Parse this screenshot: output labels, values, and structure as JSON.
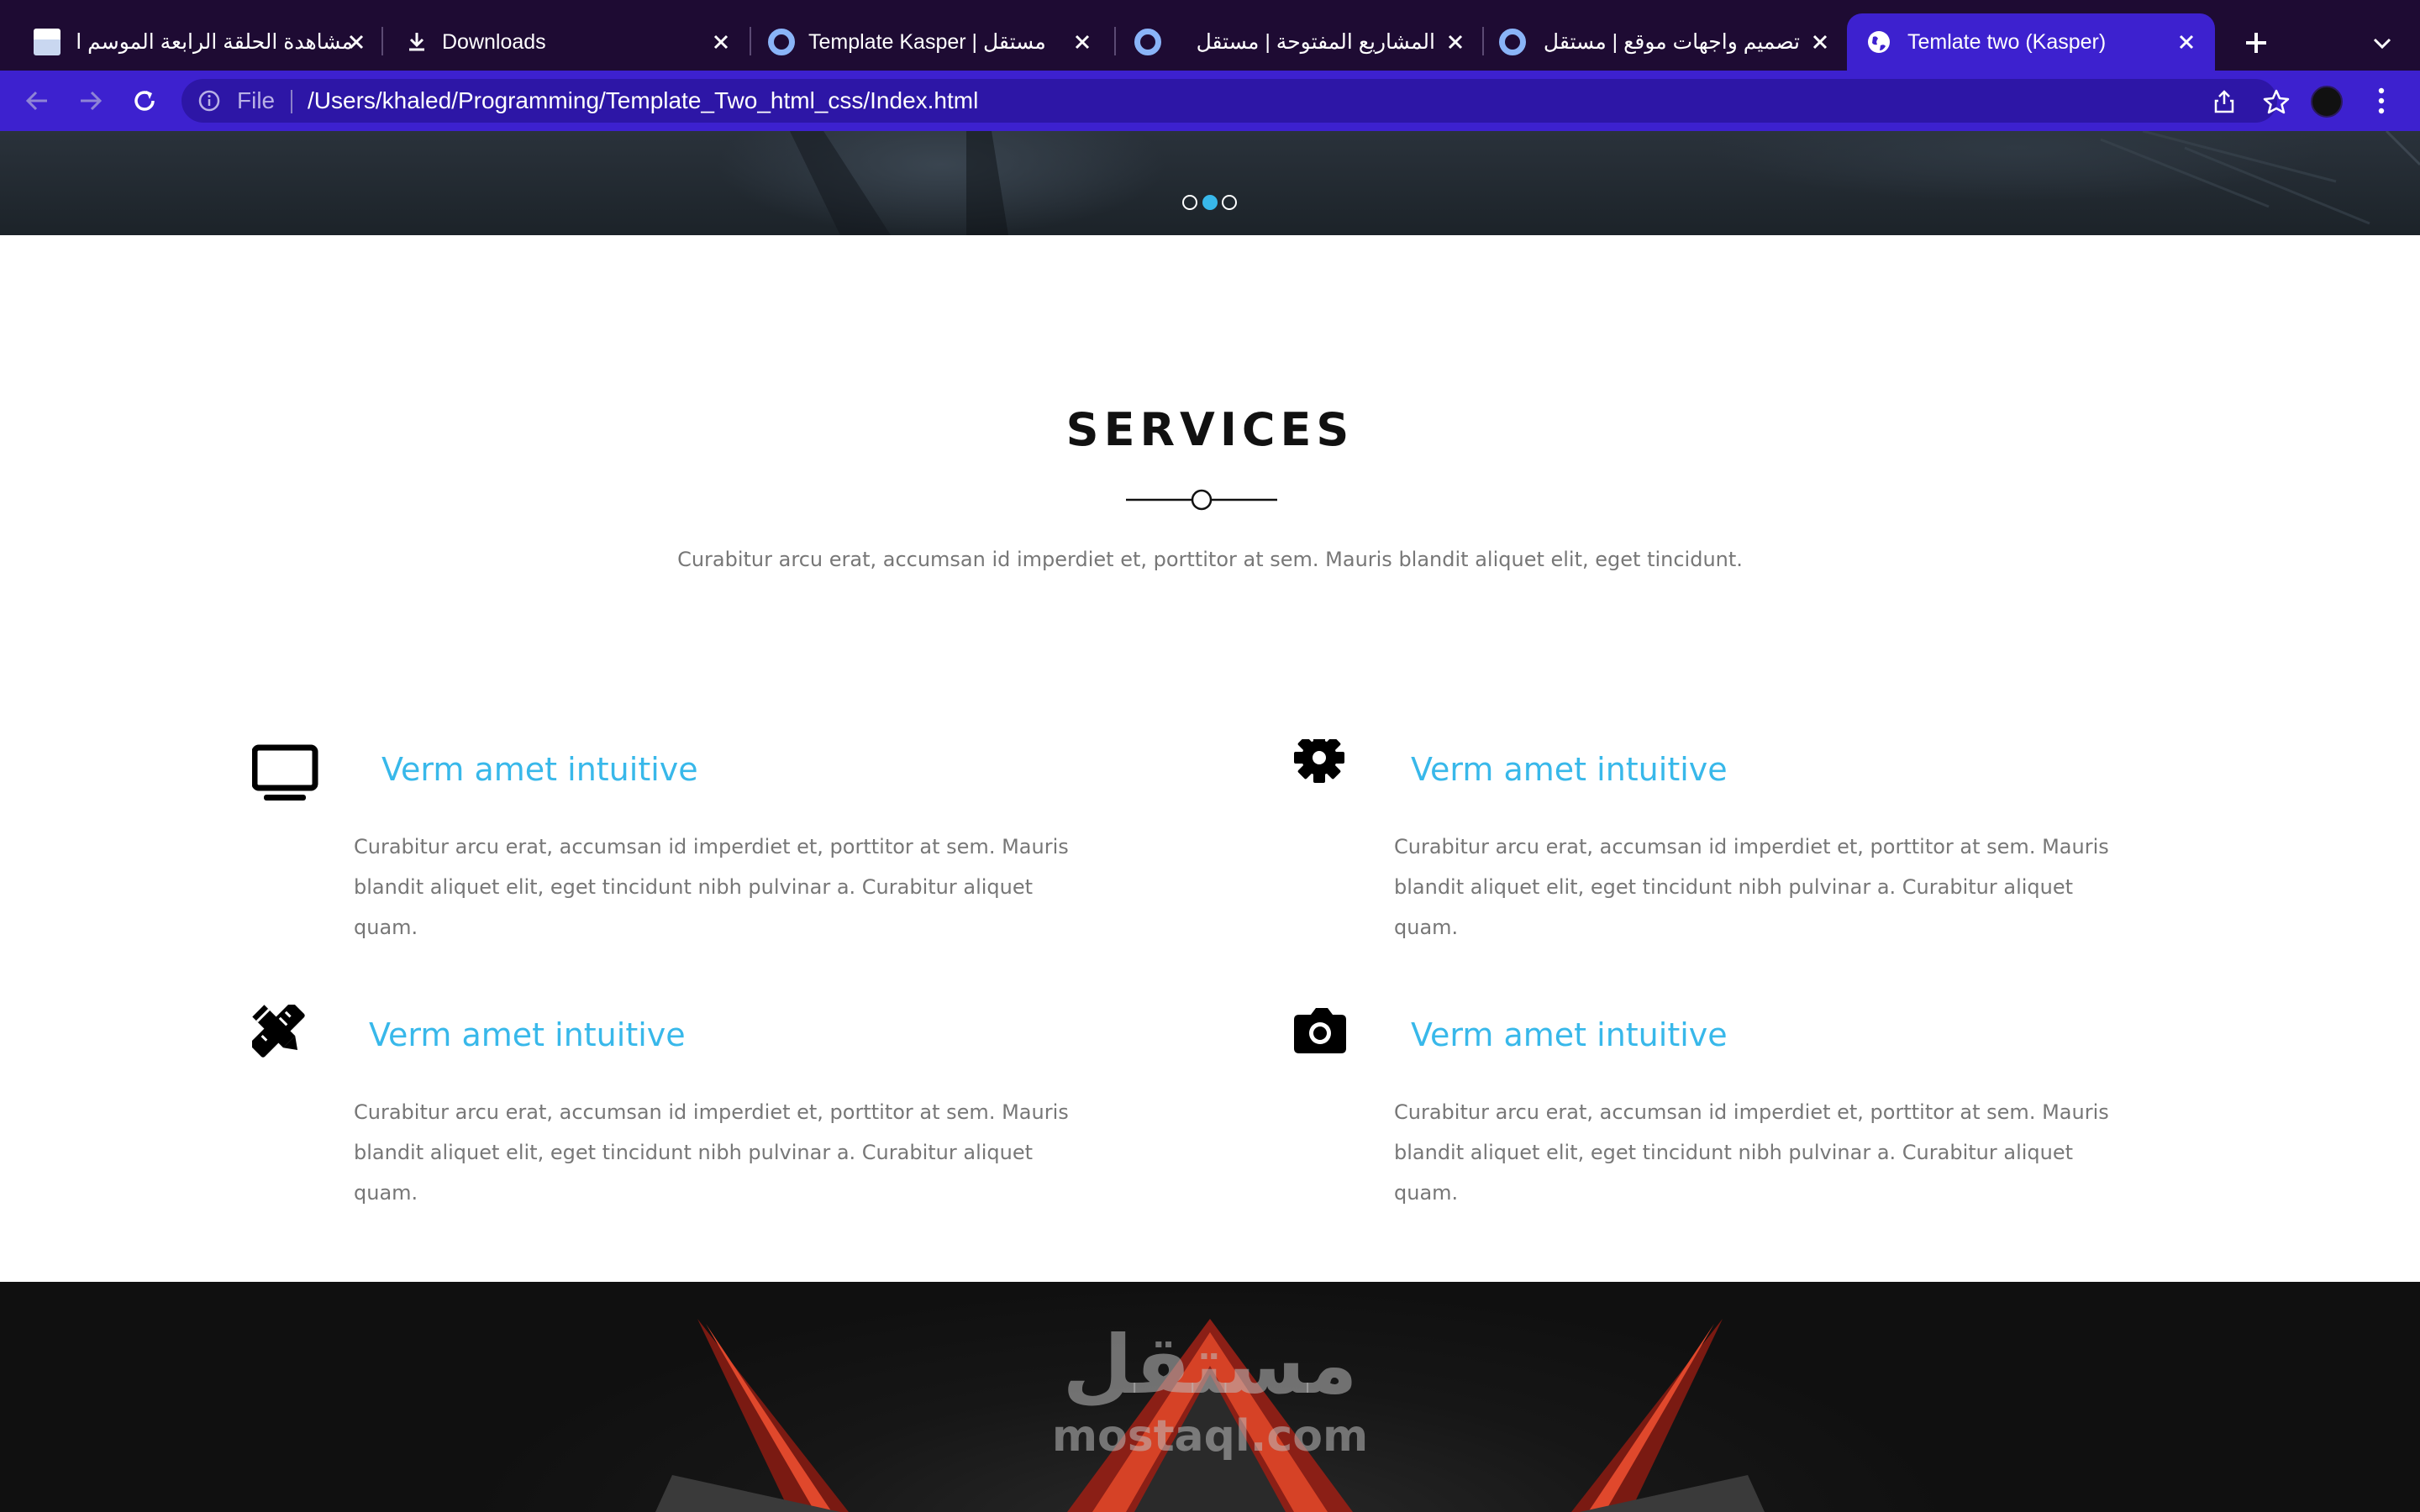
{
  "browser": {
    "tabs": [
      {
        "title": "مشاهدة الحلقة الرابعة الموسم ال",
        "favicon": "site-thumbnail-icon",
        "active": false
      },
      {
        "title": "Downloads",
        "favicon": "download-icon",
        "active": false
      },
      {
        "title": "Template Kasper | مستقل",
        "favicon": "mostaql-ring-icon",
        "active": false
      },
      {
        "title": "المشاريع المفتوحة | مستقل",
        "favicon": "mostaql-ring-icon",
        "active": false
      },
      {
        "title": "تصميم واجهات موقع | مستقل",
        "favicon": "mostaql-ring-icon",
        "active": false
      },
      {
        "title": "Temlate two (Kasper)",
        "favicon": "globe-icon",
        "active": true
      }
    ],
    "new_tab_label": "+",
    "address": {
      "scheme_label": "File",
      "url": "/Users/khaled/Programming/Template_Two_html_css/Index.html"
    },
    "colors": {
      "tabstrip": "#1e0b33",
      "toolbar": "#3d21cf",
      "omnibox": "#2d16a6"
    }
  },
  "hero": {
    "slider_bullets": [
      false,
      true,
      false
    ],
    "accent": "#38b8ea"
  },
  "services": {
    "title": "SERVICES",
    "intro": "Curabitur arcu erat, accumsan id imperdiet et, porttitor at sem. Mauris blandit aliquet elit, eget tincidunt.",
    "items": [
      {
        "icon": "tv-icon",
        "title": "Verm amet intuitive",
        "text": "Curabitur arcu erat, accumsan id imperdiet et, porttitor at sem. Mauris blandit aliquet elit, eget tincidunt nibh pulvinar a. Curabitur aliquet quam."
      },
      {
        "icon": "gear-icon",
        "title": "Verm amet intuitive",
        "text": "Curabitur arcu erat, accumsan id imperdiet et, porttitor at sem. Mauris blandit aliquet elit, eget tincidunt nibh pulvinar a. Curabitur aliquet quam."
      },
      {
        "icon": "pencil-ruler-icon",
        "title": "Verm amet intuitive",
        "text": "Curabitur arcu erat, accumsan id imperdiet et, porttitor at sem. Mauris blandit aliquet elit, eget tincidunt nibh pulvinar a. Curabitur aliquet quam."
      },
      {
        "icon": "camera-icon",
        "title": "Verm amet intuitive",
        "text": "Curabitur arcu erat, accumsan id imperdiet et, porttitor at sem. Mauris blandit aliquet elit, eget tincidunt nibh pulvinar a. Curabitur aliquet quam."
      }
    ]
  },
  "watermark": {
    "arabic": "مستقل",
    "latin": "mostaql.com"
  }
}
